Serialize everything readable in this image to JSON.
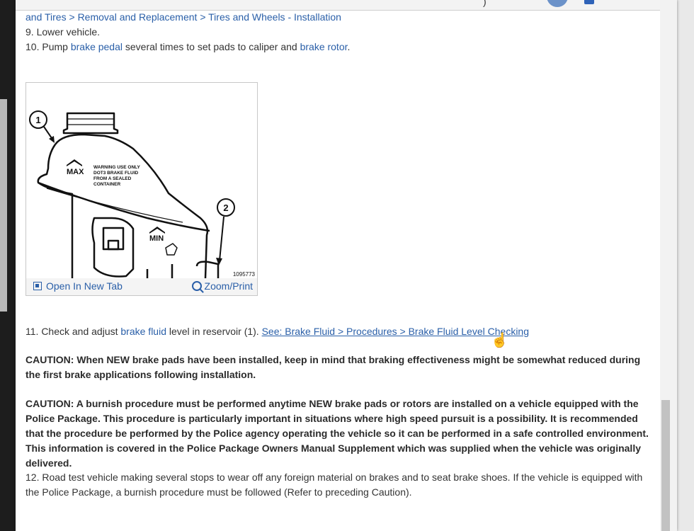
{
  "breadcrumb": {
    "part1": "and Tires",
    "sep1": " > ",
    "part2": "Removal and Replacement",
    "sep2": " > ",
    "part3": "Tires and Wheels - Installation"
  },
  "steps": {
    "s9": {
      "prefix": " 9. Lower vehicle.",
      "text": ""
    },
    "s10": {
      "prefix": "10. Pump ",
      "link1": "brake pedal",
      "mid": " several times to set pads to caliper and ",
      "link2": "brake rotor",
      "suffix": "."
    },
    "s11": {
      "prefix": "11. Check and adjust ",
      "link1": "brake fluid",
      "mid": " level in reservoir (1). ",
      "see_link": "See: Brake Fluid > Procedures > Brake Fluid Level Checking"
    },
    "s12": {
      "text": "12. Road test vehicle making several stops to wear off any foreign material on brakes and to seat brake shoes. If the vehicle is equipped with the Police Package, a burnish procedure must be followed (Refer to preceding Caution)."
    }
  },
  "figure": {
    "callout1": "1",
    "callout2": "2",
    "label_max": "MAX",
    "label_min": "MIN",
    "warning_lines": [
      "WARNING USE ONLY",
      "DOT3 BRAKE FLUID",
      "FROM A SEALED",
      "CONTAINER"
    ],
    "figure_id": "1095773",
    "open_label": "Open In New Tab",
    "zoom_label": "Zoom/Print"
  },
  "cautions": {
    "c1": "CAUTION:  When NEW brake pads have been installed, keep in mind that braking effectiveness might be somewhat reduced during the first brake applications following installation.",
    "c2": "CAUTION:  A burnish procedure must be performed anytime NEW brake pads or rotors are installed on a vehicle equipped with the Police Package. This procedure is particularly important in situations where high speed pursuit is a possibility. It is recommended that the procedure be performed by the Police agency operating the vehicle so it can be performed in a safe controlled environment. This information is covered in the Police Package Owners Manual Supplement which was supplied when the vehicle was originally delivered."
  },
  "colors": {
    "link": "#2a5fa8",
    "text": "#333333",
    "caution": "#2b2b2b"
  },
  "icons": {
    "open": "open-in-new-tab-icon",
    "zoom": "zoom-magnifier-icon",
    "cursor": "hand-pointer-icon"
  }
}
